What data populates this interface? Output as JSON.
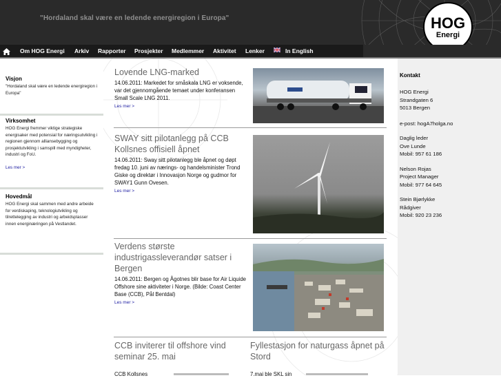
{
  "header": {
    "slogan": "\"Hordaland skal være en ledende energiregion i Europa\""
  },
  "logo": {
    "line1": "HOG",
    "line2": "Energi"
  },
  "nav": {
    "items": [
      "Om HOG Energi",
      "Arkiv",
      "Rapporter",
      "Prosjekter",
      "Medlemmer",
      "Aktivitet",
      "Lenker",
      "In English"
    ]
  },
  "left": {
    "visjon": {
      "title": "Visjon",
      "text": "\"Hordaland skal være en ledende energiregion i Europa\""
    },
    "virksomhet": {
      "title": "Virksomhet",
      "text": "HOG Energi fremmer viktige strategiske energisaker med potensial for næringsutvikling i regionen gjennom alliansebygging og prosjektutvikling i samspill med myndigheter, industri og FoU.",
      "more": "Les mer >"
    },
    "hovedmal": {
      "title": "Hovedmål",
      "text": "HOG Energi skal sammen med andre arbeide for verdiskaping, teknologiutvikling og tilrettelegging av industri og arbeidsplasser innen energinæringen på Vestlandet."
    }
  },
  "articles": [
    {
      "title": "Lovende LNG-marked",
      "text": "14.06.2011:  Markedet for småskala LNG er voksende, var det gjennomgående temaet under konferansen Small Scale LNG 2011.",
      "more": "Les mer >"
    },
    {
      "title": "SWAY sitt pilotanlegg på CCB Kollsnes offisiell åpnet",
      "text": "14.06.2011:  Sway sitt pilotanlegg ble åpnet og døpt fredag 10. juni av nærings- og handelsminister Trond Giske og direktør i Innovasjon Norge og gudmor for SWAY1 Gunn Ovesen.",
      "more": "Les mer >"
    },
    {
      "title": "Verdens største industrigassleverandør satser i Bergen",
      "text": "14.06.2011:  Bergen og Ågotnes blir base for Air Liquide Offshore sine aktiviteter i Norge. (Bilde: Coast Center Base (CCB), Pål Bentdal)",
      "more": "Les mer >"
    }
  ],
  "bottom": [
    {
      "title": "CCB inviterer til offshore vind seminar 25. mai",
      "text": "CCB Kollsnes"
    },
    {
      "title": "Fyllestasjon for naturgass åpnet på Stord",
      "text": "7.mai ble SKL sin"
    }
  ],
  "contact": {
    "title": "Kontakt",
    "org": [
      "HOG Energi",
      "Strandgaten 6",
      "5013 Bergen"
    ],
    "email": "e-post: hogA7holga.no",
    "people": [
      [
        "Daglig leder",
        "Ove Lunde",
        "Mobil: 957 61 186"
      ],
      [
        "Nelson Rojas",
        "Project Manager",
        "Mobil: 977 64 645"
      ],
      [
        "Stein Bjørlykke",
        "Rådgiver",
        "Mobil: 920 23 236"
      ]
    ]
  },
  "icons": {
    "home": "home-icon",
    "flag": "uk-flag-icon"
  },
  "colors": {
    "header_bg": "#2a2a2a",
    "nav_bg": "#1a1a1a",
    "link": "#1a1aa0",
    "title_gray": "#666666",
    "sidebar_bg": "#f0f0f0"
  }
}
